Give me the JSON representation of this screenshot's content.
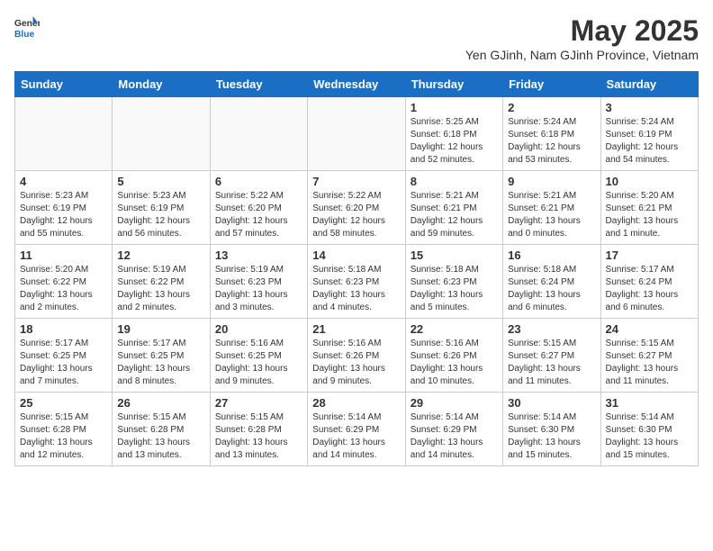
{
  "header": {
    "logo_line1": "General",
    "logo_line2": "Blue",
    "title": "May 2025",
    "subtitle": "Yen GJinh, Nam GJinh Province, Vietnam"
  },
  "weekdays": [
    "Sunday",
    "Monday",
    "Tuesday",
    "Wednesday",
    "Thursday",
    "Friday",
    "Saturday"
  ],
  "weeks": [
    [
      {
        "day": "",
        "info": ""
      },
      {
        "day": "",
        "info": ""
      },
      {
        "day": "",
        "info": ""
      },
      {
        "day": "",
        "info": ""
      },
      {
        "day": "1",
        "info": "Sunrise: 5:25 AM\nSunset: 6:18 PM\nDaylight: 12 hours\nand 52 minutes."
      },
      {
        "day": "2",
        "info": "Sunrise: 5:24 AM\nSunset: 6:18 PM\nDaylight: 12 hours\nand 53 minutes."
      },
      {
        "day": "3",
        "info": "Sunrise: 5:24 AM\nSunset: 6:19 PM\nDaylight: 12 hours\nand 54 minutes."
      }
    ],
    [
      {
        "day": "4",
        "info": "Sunrise: 5:23 AM\nSunset: 6:19 PM\nDaylight: 12 hours\nand 55 minutes."
      },
      {
        "day": "5",
        "info": "Sunrise: 5:23 AM\nSunset: 6:19 PM\nDaylight: 12 hours\nand 56 minutes."
      },
      {
        "day": "6",
        "info": "Sunrise: 5:22 AM\nSunset: 6:20 PM\nDaylight: 12 hours\nand 57 minutes."
      },
      {
        "day": "7",
        "info": "Sunrise: 5:22 AM\nSunset: 6:20 PM\nDaylight: 12 hours\nand 58 minutes."
      },
      {
        "day": "8",
        "info": "Sunrise: 5:21 AM\nSunset: 6:21 PM\nDaylight: 12 hours\nand 59 minutes."
      },
      {
        "day": "9",
        "info": "Sunrise: 5:21 AM\nSunset: 6:21 PM\nDaylight: 13 hours\nand 0 minutes."
      },
      {
        "day": "10",
        "info": "Sunrise: 5:20 AM\nSunset: 6:21 PM\nDaylight: 13 hours\nand 1 minute."
      }
    ],
    [
      {
        "day": "11",
        "info": "Sunrise: 5:20 AM\nSunset: 6:22 PM\nDaylight: 13 hours\nand 2 minutes."
      },
      {
        "day": "12",
        "info": "Sunrise: 5:19 AM\nSunset: 6:22 PM\nDaylight: 13 hours\nand 2 minutes."
      },
      {
        "day": "13",
        "info": "Sunrise: 5:19 AM\nSunset: 6:23 PM\nDaylight: 13 hours\nand 3 minutes."
      },
      {
        "day": "14",
        "info": "Sunrise: 5:18 AM\nSunset: 6:23 PM\nDaylight: 13 hours\nand 4 minutes."
      },
      {
        "day": "15",
        "info": "Sunrise: 5:18 AM\nSunset: 6:23 PM\nDaylight: 13 hours\nand 5 minutes."
      },
      {
        "day": "16",
        "info": "Sunrise: 5:18 AM\nSunset: 6:24 PM\nDaylight: 13 hours\nand 6 minutes."
      },
      {
        "day": "17",
        "info": "Sunrise: 5:17 AM\nSunset: 6:24 PM\nDaylight: 13 hours\nand 6 minutes."
      }
    ],
    [
      {
        "day": "18",
        "info": "Sunrise: 5:17 AM\nSunset: 6:25 PM\nDaylight: 13 hours\nand 7 minutes."
      },
      {
        "day": "19",
        "info": "Sunrise: 5:17 AM\nSunset: 6:25 PM\nDaylight: 13 hours\nand 8 minutes."
      },
      {
        "day": "20",
        "info": "Sunrise: 5:16 AM\nSunset: 6:25 PM\nDaylight: 13 hours\nand 9 minutes."
      },
      {
        "day": "21",
        "info": "Sunrise: 5:16 AM\nSunset: 6:26 PM\nDaylight: 13 hours\nand 9 minutes."
      },
      {
        "day": "22",
        "info": "Sunrise: 5:16 AM\nSunset: 6:26 PM\nDaylight: 13 hours\nand 10 minutes."
      },
      {
        "day": "23",
        "info": "Sunrise: 5:15 AM\nSunset: 6:27 PM\nDaylight: 13 hours\nand 11 minutes."
      },
      {
        "day": "24",
        "info": "Sunrise: 5:15 AM\nSunset: 6:27 PM\nDaylight: 13 hours\nand 11 minutes."
      }
    ],
    [
      {
        "day": "25",
        "info": "Sunrise: 5:15 AM\nSunset: 6:28 PM\nDaylight: 13 hours\nand 12 minutes."
      },
      {
        "day": "26",
        "info": "Sunrise: 5:15 AM\nSunset: 6:28 PM\nDaylight: 13 hours\nand 13 minutes."
      },
      {
        "day": "27",
        "info": "Sunrise: 5:15 AM\nSunset: 6:28 PM\nDaylight: 13 hours\nand 13 minutes."
      },
      {
        "day": "28",
        "info": "Sunrise: 5:14 AM\nSunset: 6:29 PM\nDaylight: 13 hours\nand 14 minutes."
      },
      {
        "day": "29",
        "info": "Sunrise: 5:14 AM\nSunset: 6:29 PM\nDaylight: 13 hours\nand 14 minutes."
      },
      {
        "day": "30",
        "info": "Sunrise: 5:14 AM\nSunset: 6:30 PM\nDaylight: 13 hours\nand 15 minutes."
      },
      {
        "day": "31",
        "info": "Sunrise: 5:14 AM\nSunset: 6:30 PM\nDaylight: 13 hours\nand 15 minutes."
      }
    ]
  ]
}
